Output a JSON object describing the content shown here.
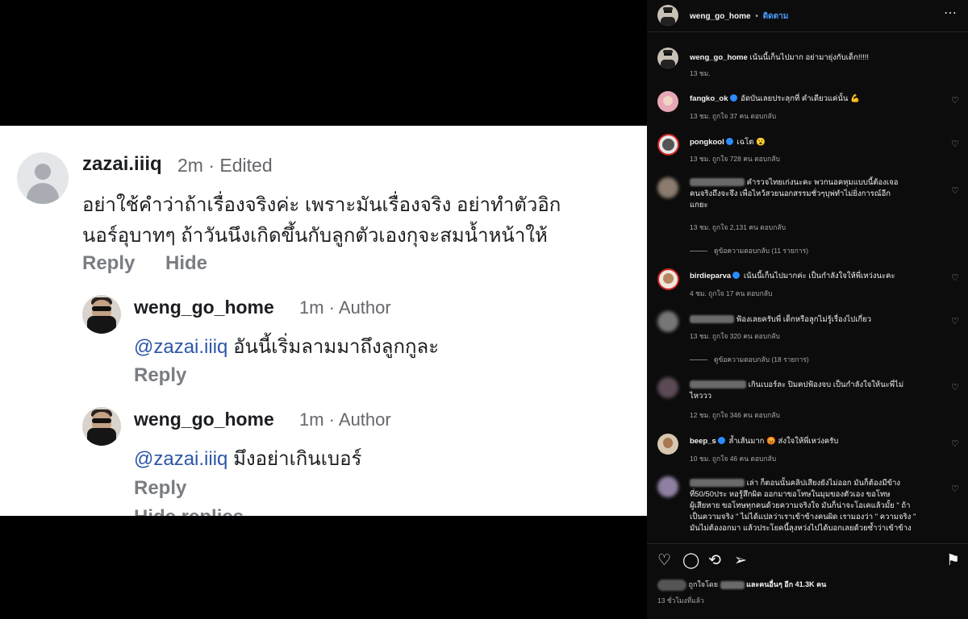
{
  "card": {
    "comment": {
      "user": "zazai.iiiq",
      "meta": "2m · Edited",
      "text_line1": "อย่าใช้คำว่าถ้าเรื่องจริงค่ะ เพราะมันเรื่องจริง อย่าทำตัวอิก",
      "text_line2": "นอร์อุบาทๆ ถ้าวันนึงเกิดขึ้นกับลูกตัวเองกุจะสมน้ำหน้าให้",
      "reply_label": "Reply",
      "hide_label": "Hide"
    },
    "replies": [
      {
        "user": "weng_go_home",
        "meta": "1m · Author",
        "mention": "@zazai.iiiq",
        "text": " อันนี้เริ่มลามมาถึงลูกกูละ",
        "reply_label": "Reply"
      },
      {
        "user": "weng_go_home",
        "meta": "1m · Author",
        "mention": "@zazai.iiiq",
        "text": " มึงอย่าเกินเบอร์",
        "reply_label": "Reply"
      }
    ],
    "hide_replies_label": "Hide replies"
  },
  "panel": {
    "header": {
      "user": "weng_go_home",
      "dot": "•",
      "follow": "ติดตาม",
      "more": "⋯"
    },
    "caption": {
      "user": "weng_go_home",
      "text": "เน้นนี้เก็นไปมาก อย่ามายุ่งกับเด็ก!!!!!",
      "time": "13 ชม."
    },
    "comments": [
      {
        "user": "fangko_ok",
        "text": "อัดบันเลยประลุกที่ คำเดียวแค่นั้น 💪",
        "meta": "13 ชม.    ถูกใจ 37 คน    ตอบกลับ"
      },
      {
        "user": "pongkool",
        "text": "เฉโต 😮",
        "meta": "13 ชม.    ถูกใจ 728 คน    ตอบกลับ"
      },
      {
        "user": "",
        "text_line1": "คำรวจไทยเก่งนะคะ พวกนอคหุมแบบนี้ต้องเจอ",
        "text_line2": "คนจริงถึงจะจึง เพื่อไหว้สวยนอกสรรมชั่วๆบุพ่ทำไม่ยิ่งการณ์อีก",
        "text_line3": "แกยะ",
        "meta": "13 ชม.    ถูกใจ 2,131 คน    ตอบกลับ",
        "view_replies": "ดูข้อความตอบกลับ (11 รายการ)"
      },
      {
        "user": "birdieparva",
        "text": "เน้นนี้เก็นไปมากค่ะ เป็นกำลังใจให้พี่เหว่งนะคะ",
        "meta": "4 ชม.    ถูกใจ 17 คน    ตอบกลับ"
      },
      {
        "user": "",
        "text": "ฟ้องเลยครับพี่ เด็กหรือลูกไม่รู้เรื่องไปเกี่ยว",
        "meta": "13 ชม.    ถูกใจ 320 คน    ตอบกลับ",
        "view_replies": "ดูข้อความตอบกลับ (18 รายการ)"
      },
      {
        "user": "",
        "text_line1": "เกินเบอร์ละ ปิมคปฟ้องจบ เป็นกำลังใจให้นะพี่ไม่",
        "text_line2": "ไหววว",
        "meta": "12 ชม.    ถูกใจ 346 คน    ตอบกลับ"
      },
      {
        "user": "beep_s",
        "text": "ล้ำเส้นมาก 😡 ส่งใจให้พี่เหว่งครับ",
        "meta": "10 ชม.    ถูกใจ 46 คน    ตอบกลับ"
      },
      {
        "user": "",
        "text_line1": "เล่า ก็ตอนนั้นคลิปเสียงยังไม่ออก มันก็ต้องมีข้าง",
        "text_line2": "ที่50/50ประ หอรู้สึกผิด ออกมาขอโทษในมุมของตัวเอง ขอโทษ",
        "text_line3": "ผู้เสียหาย ขอโทษทุกคนด้วยความจริงใจ มันก็น่าจะโอเคแล้วมั้ย \" ถ้า",
        "text_line4": "เป็นความจริง \" ไม่ได้แปลว่าเราเข้าข้างคนผิด เรามองว่า \" ความจริง \"",
        "text_line5": "มันไม่ต้องอกมา แล้วประโยคนี้ลุงหว่งไปได้บอกเลยด้วยซ้ำว่าเข้าข้าง"
      }
    ],
    "likes_text": "ถูกใจโดย",
    "likes_more": "และคนอื่นๆ อีก 41.3K คน",
    "post_time": "13 ชั่วโมงที่แล้ว"
  }
}
